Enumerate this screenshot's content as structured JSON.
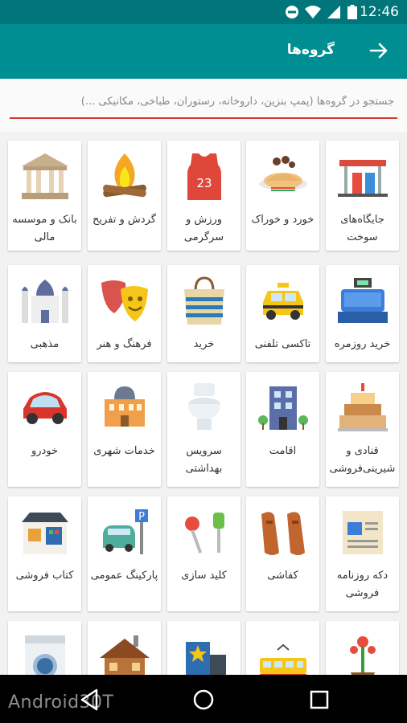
{
  "status": {
    "time": "12:46"
  },
  "appbar": {
    "title": "گروه‌ها"
  },
  "search": {
    "placeholder": "جستجو در گروه‌ها (پمپ بنزین، داروخانه، رستوران، طباخی، مکانیکی ...)"
  },
  "categories": [
    {
      "label": "جایگاه‌های سوخت",
      "icon": "gas-station-icon"
    },
    {
      "label": "خورد و خوراک",
      "icon": "food-plate-icon"
    },
    {
      "label": "ورزش و سرگرمی",
      "icon": "jersey-icon"
    },
    {
      "label": "گردش و تفریح",
      "icon": "campfire-icon"
    },
    {
      "label": "بانک و موسسه مالی",
      "icon": "bank-icon"
    },
    {
      "label": "خرید روزمره",
      "icon": "cash-register-icon"
    },
    {
      "label": "تاکسی تلفنی",
      "icon": "taxi-icon"
    },
    {
      "label": "خرید",
      "icon": "shopping-bag-icon"
    },
    {
      "label": "فرهنگ و هنر",
      "icon": "theater-masks-icon"
    },
    {
      "label": "مذهبی",
      "icon": "mosque-icon"
    },
    {
      "label": "قنادی و شیرینی‌فروشی",
      "icon": "cake-icon"
    },
    {
      "label": "اقامت",
      "icon": "hotel-icon"
    },
    {
      "label": "سرویس بهداشتی",
      "icon": "toilet-icon"
    },
    {
      "label": "خدمات شهری",
      "icon": "city-hall-icon"
    },
    {
      "label": "خودرو",
      "icon": "car-icon"
    },
    {
      "label": "دکه روزنامه فروشی",
      "icon": "newspaper-icon"
    },
    {
      "label": "کفاشی",
      "icon": "shoes-icon"
    },
    {
      "label": "کلید سازی",
      "icon": "keys-icon"
    },
    {
      "label": "پارکینگ عمومی",
      "icon": "parking-icon"
    },
    {
      "label": "کتاب فروشی",
      "icon": "bookstore-icon"
    },
    {
      "label": "",
      "icon": "flower-pot-icon"
    },
    {
      "label": "",
      "icon": "tram-icon"
    },
    {
      "label": "",
      "icon": "building-star-icon"
    },
    {
      "label": "",
      "icon": "wooden-house-icon"
    },
    {
      "label": "",
      "icon": "washing-machine-icon"
    }
  ],
  "watermark": "Android30T"
}
